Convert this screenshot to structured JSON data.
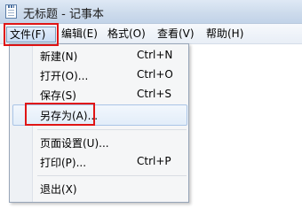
{
  "window": {
    "title": "无标题 - 记事本"
  },
  "menubar": {
    "items": [
      "文件(F)",
      "编辑(E)",
      "格式(O)",
      "查看(V)",
      "帮助(H)"
    ]
  },
  "file_menu": {
    "items": [
      {
        "label": "新建(N)",
        "shortcut": "Ctrl+N"
      },
      {
        "label": "打开(O)...",
        "shortcut": "Ctrl+O"
      },
      {
        "label": "保存(S)",
        "shortcut": "Ctrl+S"
      },
      {
        "label": "另存为(A)...",
        "shortcut": ""
      },
      {
        "label": "页面设置(U)...",
        "shortcut": ""
      },
      {
        "label": "打印(P)...",
        "shortcut": "Ctrl+P"
      },
      {
        "label": "退出(X)",
        "shortcut": ""
      }
    ]
  },
  "annotation_color": "#e01515"
}
